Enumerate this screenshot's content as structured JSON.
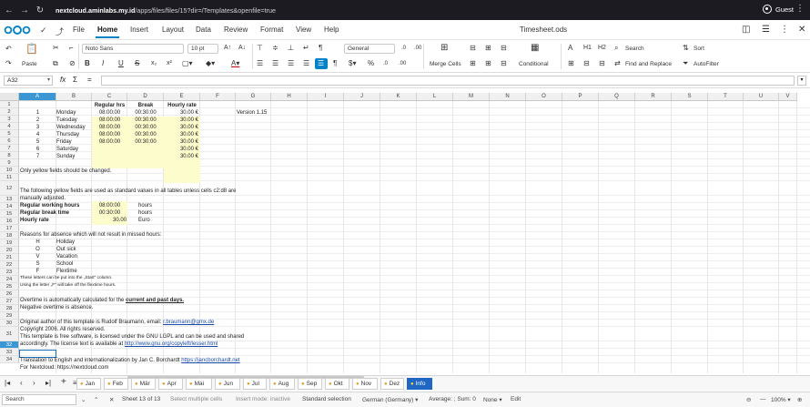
{
  "browser": {
    "url_host": "nextcloud.aminlabs.my.id",
    "url_path": "/apps/files/files/15?dir=/Templates&openfile=true",
    "profile_label": "Guest"
  },
  "app": {
    "document_title": "Timesheet.ods",
    "menu_tabs": [
      "File",
      "Home",
      "Insert",
      "Layout",
      "Data",
      "Review",
      "Format",
      "View",
      "Help"
    ],
    "active_tab": "Home"
  },
  "toolbar": {
    "paste_label": "Paste",
    "font_name": "Noto Sans",
    "font_size": "10 pt",
    "number_format": "General",
    "merge_label": "Merge Cells",
    "conditional_label": "Conditional",
    "search_label": "Search",
    "sort_label": "Sort",
    "find_replace_label": "Find and Replace",
    "autofilter_label": "AutoFilter",
    "h1": "H1",
    "h2": "H2"
  },
  "formula_bar": {
    "cell_ref": "A32",
    "fx_symbol": "fx",
    "sum_symbol": "Σ",
    "eq_symbol": "="
  },
  "columns": [
    "A",
    "B",
    "C",
    "D",
    "E",
    "F",
    "G",
    "H",
    "I",
    "J",
    "K",
    "L",
    "M",
    "N",
    "O",
    "P",
    "Q",
    "R",
    "S",
    "T",
    "U",
    "V"
  ],
  "rows": [
    "1",
    "2",
    "3",
    "4",
    "5",
    "6",
    "7",
    "8",
    "9",
    "10",
    "11",
    "12",
    "13",
    "14",
    "15",
    "16",
    "17",
    "18",
    "19",
    "20",
    "21",
    "22",
    "23",
    "24",
    "25",
    "26",
    "27",
    "28",
    "29",
    "30",
    "31",
    "32",
    "33",
    "34"
  ],
  "sheet": {
    "header_regular": "Regular hrs",
    "header_break": "Break",
    "header_rate": "Hourly rate",
    "version": "Version 1.15",
    "days": [
      {
        "n": "1",
        "day": "Monday",
        "regular": "08:00:00",
        "break": "00:30:00",
        "rate": "30.00 €"
      },
      {
        "n": "2",
        "day": "Tuesday",
        "regular": "08:00:00",
        "break": "00:30:00",
        "rate": "30.00 €"
      },
      {
        "n": "3",
        "day": "Wednesday",
        "regular": "08:00:00",
        "break": "00:30:00",
        "rate": "30.00 €"
      },
      {
        "n": "4",
        "day": "Thursday",
        "regular": "08:00:00",
        "break": "00:30:00",
        "rate": "30.00 €"
      },
      {
        "n": "5",
        "day": "Friday",
        "regular": "08:00:00",
        "break": "00:30:00",
        "rate": "30.00 €"
      },
      {
        "n": "6",
        "day": "Saturday",
        "regular": "",
        "break": "",
        "rate": "30.00 €"
      },
      {
        "n": "7",
        "day": "Sunday",
        "regular": "",
        "break": "",
        "rate": "30.00 €"
      }
    ],
    "note_yellow": "Only yellow fields should be changed.",
    "note_standard_1": "The following yellow fields are used as standard values in all tables unless cells c2:d8 are",
    "note_standard_2": "manually adjusted.",
    "label_working_hours": "Regular working hours",
    "label_break_time": "Regular break time",
    "label_hourly_rate": "Hourly rate",
    "value_working_hours": "08:00:00",
    "value_break_time": "00:30:00",
    "value_hourly_rate": "30.00",
    "unit_hours_1": "hours",
    "unit_hours_2": "hours",
    "unit_euro": "Euro",
    "absence_intro": "Reasons for absence which will not result in missed hours:",
    "absence": [
      {
        "code": "H",
        "label": "Holiday"
      },
      {
        "code": "O",
        "label": "Out sick"
      },
      {
        "code": "V",
        "label": "Vacation"
      },
      {
        "code": "S",
        "label": "School"
      },
      {
        "code": "F",
        "label": "Flextime"
      }
    ],
    "note_letters_1": "These letters can be put into the „Start\" column.",
    "note_letters_2": "Using the letter „F\" will take off the flextime hours.",
    "overtime_prefix": "Overtime is automatically calculated for the ",
    "overtime_emph": "current and past days.",
    "overtime_negative": "Negative overtime is absence.",
    "author_prefix": "Original author of this template is Rudolf Braumann, email: ",
    "author_email": "r.braumann@gmx.de",
    "copyright": "Copyright 2006. All rights reserved.",
    "license_1": "This template is free software, is licensed under the GNU LGPL and can be used and shared",
    "license_2_prefix": "accordingly. The license text is available at ",
    "license_url": "http://www.gnu.org/copyleft/lesser.html",
    "translation_prefix": "Translation to English and internationalization by Jan C. Borchardt ",
    "translation_url": "https://jancborchardt.net",
    "nextcloud_prefix": "For Nextcloud: ",
    "nextcloud_url": "https://nextcloud.com"
  },
  "sheet_tabs": [
    "Jan",
    "Feb",
    "Mär",
    "Apr",
    "Mai",
    "Jun",
    "Jul",
    "Aug",
    "Sep",
    "Okt",
    "Nov",
    "Dez",
    "Info"
  ],
  "active_sheet_tab": "Info",
  "status": {
    "search_placeholder": "Search",
    "sheet_info": "Sheet 13 of 13",
    "select_mode": "Select multiple cells",
    "insert_mode": "Insert mode: inactive",
    "selection_mode": "Standard selection",
    "language": "German (Germany)",
    "summary": "Average: ; Sum: 0",
    "none_label": "None",
    "edit_label": "Edit",
    "zoom": "100%"
  },
  "colors": {
    "accent": "#0082c9",
    "selection": "#1a6fb7",
    "yellow_fill": "#fdfccd",
    "tab_active": "#1f67c2"
  }
}
